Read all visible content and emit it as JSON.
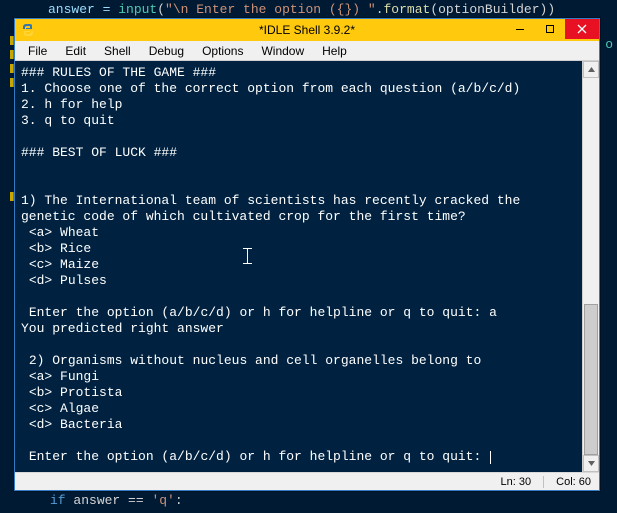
{
  "bg_editor": {
    "line1_pre": "answer = ",
    "line1_fn": "input",
    "line1_paren1": "(",
    "line1_str": "\"\\n Enter the option ({}) \"",
    "line1_dot": ".",
    "line1_fmt": "format",
    "line1_paren2": "(optionBuilder))",
    "if_kw": "if",
    "if_rest": " answer == ",
    "if_str": "'q'",
    "if_colon": ":",
    "right_o": "o"
  },
  "window": {
    "title": "*IDLE Shell 3.9.2*"
  },
  "menu": {
    "file": "File",
    "edit": "Edit",
    "shell": "Shell",
    "debug": "Debug",
    "options": "Options",
    "window": "Window",
    "help": "Help"
  },
  "shell": {
    "rules_header_partial": "### RULES OF THE GAME ###",
    "rule1": "1. Choose one of the correct option from each question (a/b/c/d)",
    "rule2": "2. h for help",
    "rule3": "3. q to quit",
    "luck": "### BEST OF LUCK ###",
    "q1": "1) The International team of scientists has recently cracked the genetic code of which cultivated crop for the first time?",
    "q1a": " <a> Wheat",
    "q1b": " <b> Rice",
    "q1c": " <c> Maize",
    "q1d": " <d> Pulses",
    "prompt1": " Enter the option (a/b/c/d) or h for helpline or q to quit: a",
    "feedback1": "You predicted right answer",
    "q2": " 2) Organisms without nucleus and cell organelles belong to",
    "q2a": " <a> Fungi",
    "q2b": " <b> Protista",
    "q2c": " <c> Algae",
    "q2d": " <d> Bacteria",
    "prompt2": " Enter the option (a/b/c/d) or h for helpline or q to quit: "
  },
  "status": {
    "ln": "Ln: 30",
    "col": "Col: 60"
  }
}
